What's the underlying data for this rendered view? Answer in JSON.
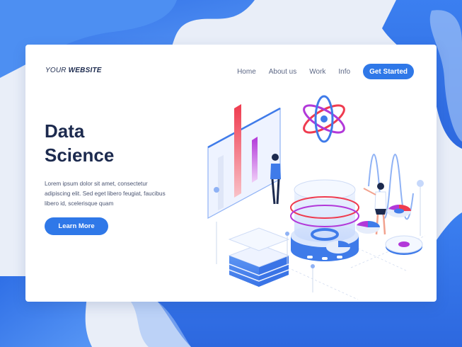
{
  "brand": {
    "prefix": "YOUR ",
    "name": "WEBSITE"
  },
  "nav": {
    "items": [
      "Home",
      "About us",
      "Work",
      "Info"
    ],
    "cta": "Get Started"
  },
  "hero": {
    "title_line1": "Data",
    "title_line2": "Science",
    "description": "Lorem ipsum dolor sit amet, consectetur adipiscing elit. Sed eget libero feugiat, faucibus libero id, scelerisque quam",
    "button": "Learn More"
  },
  "colors": {
    "accent": "#2f78e8",
    "dark_text": "#1c2a4e",
    "background_blue": "#3b7ff0"
  }
}
